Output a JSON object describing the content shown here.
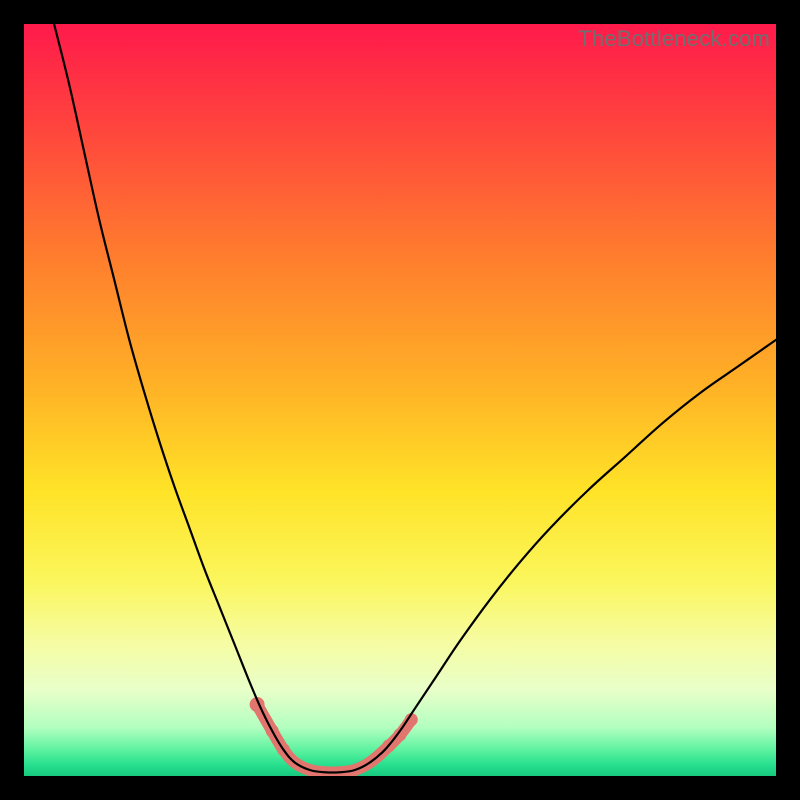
{
  "watermark": "TheBottleneck.com",
  "chart_data": {
    "type": "line",
    "title": "",
    "xlabel": "",
    "ylabel": "",
    "xlim": [
      0,
      100
    ],
    "ylim": [
      0,
      100
    ],
    "background_gradient": {
      "stops": [
        {
          "offset": 0.0,
          "color": "#ff1a4b"
        },
        {
          "offset": 0.12,
          "color": "#ff3f3f"
        },
        {
          "offset": 0.3,
          "color": "#ff7a2e"
        },
        {
          "offset": 0.48,
          "color": "#ffb126"
        },
        {
          "offset": 0.62,
          "color": "#ffe327"
        },
        {
          "offset": 0.74,
          "color": "#fbf65c"
        },
        {
          "offset": 0.82,
          "color": "#f6fca0"
        },
        {
          "offset": 0.885,
          "color": "#e9ffc9"
        },
        {
          "offset": 0.935,
          "color": "#b3ffc0"
        },
        {
          "offset": 0.965,
          "color": "#5ef2a0"
        },
        {
          "offset": 0.985,
          "color": "#27e08e"
        },
        {
          "offset": 1.0,
          "color": "#17c97e"
        }
      ]
    },
    "series": [
      {
        "name": "bottleneck-curve",
        "stroke": "#000000",
        "stroke_width": 2.2,
        "points": [
          {
            "x": 4.0,
            "y": 100.0
          },
          {
            "x": 6.0,
            "y": 92.0
          },
          {
            "x": 8.0,
            "y": 83.0
          },
          {
            "x": 10.0,
            "y": 74.0
          },
          {
            "x": 12.0,
            "y": 66.0
          },
          {
            "x": 14.0,
            "y": 58.0
          },
          {
            "x": 16.0,
            "y": 51.0
          },
          {
            "x": 18.0,
            "y": 44.5
          },
          {
            "x": 20.0,
            "y": 38.5
          },
          {
            "x": 22.0,
            "y": 33.0
          },
          {
            "x": 24.0,
            "y": 27.5
          },
          {
            "x": 26.0,
            "y": 22.5
          },
          {
            "x": 28.0,
            "y": 17.5
          },
          {
            "x": 30.0,
            "y": 12.5
          },
          {
            "x": 31.5,
            "y": 9.0
          },
          {
            "x": 33.0,
            "y": 6.0
          },
          {
            "x": 34.5,
            "y": 3.5
          },
          {
            "x": 36.0,
            "y": 1.8
          },
          {
            "x": 38.0,
            "y": 0.8
          },
          {
            "x": 40.0,
            "y": 0.5
          },
          {
            "x": 42.0,
            "y": 0.5
          },
          {
            "x": 44.0,
            "y": 0.8
          },
          {
            "x": 46.0,
            "y": 1.8
          },
          {
            "x": 48.0,
            "y": 3.5
          },
          {
            "x": 50.0,
            "y": 6.0
          },
          {
            "x": 52.0,
            "y": 9.0
          },
          {
            "x": 55.0,
            "y": 13.5
          },
          {
            "x": 58.0,
            "y": 18.0
          },
          {
            "x": 62.0,
            "y": 23.5
          },
          {
            "x": 66.0,
            "y": 28.5
          },
          {
            "x": 70.0,
            "y": 33.0
          },
          {
            "x": 75.0,
            "y": 38.0
          },
          {
            "x": 80.0,
            "y": 42.5
          },
          {
            "x": 85.0,
            "y": 47.0
          },
          {
            "x": 90.0,
            "y": 51.0
          },
          {
            "x": 95.0,
            "y": 54.5
          },
          {
            "x": 100.0,
            "y": 58.0
          }
        ]
      },
      {
        "name": "highlight-band",
        "stroke": "#e2766e",
        "stroke_width": 12,
        "points": [
          {
            "x": 31.0,
            "y": 9.5
          },
          {
            "x": 33.0,
            "y": 6.0
          },
          {
            "x": 34.5,
            "y": 3.5
          },
          {
            "x": 36.0,
            "y": 1.8
          },
          {
            "x": 38.0,
            "y": 0.8
          },
          {
            "x": 40.0,
            "y": 0.5
          },
          {
            "x": 42.0,
            "y": 0.5
          },
          {
            "x": 44.0,
            "y": 0.8
          },
          {
            "x": 46.0,
            "y": 1.8
          },
          {
            "x": 48.0,
            "y": 3.5
          },
          {
            "x": 50.0,
            "y": 5.5
          },
          {
            "x": 51.5,
            "y": 7.5
          }
        ]
      }
    ],
    "markers": [
      {
        "x": 31.0,
        "y": 9.5,
        "r": 7.5,
        "color": "#e2766e"
      },
      {
        "x": 33.0,
        "y": 6.0,
        "r": 6.5,
        "color": "#e2766e"
      },
      {
        "x": 34.5,
        "y": 3.5,
        "r": 6.5,
        "color": "#e2766e"
      },
      {
        "x": 48.5,
        "y": 4.0,
        "r": 6.5,
        "color": "#e2766e"
      },
      {
        "x": 50.0,
        "y": 5.5,
        "r": 6.5,
        "color": "#e2766e"
      },
      {
        "x": 51.5,
        "y": 7.5,
        "r": 6.5,
        "color": "#e2766e"
      }
    ]
  }
}
